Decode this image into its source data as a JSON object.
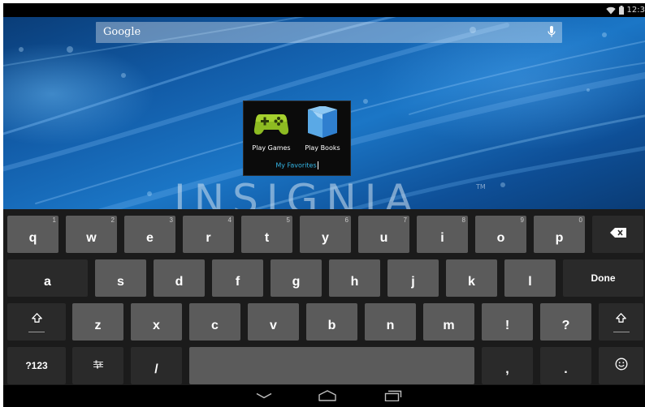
{
  "status_bar": {
    "time": "12:3"
  },
  "search": {
    "label": "Google"
  },
  "folder": {
    "apps": [
      {
        "label": "Play Games"
      },
      {
        "label": "Play Books"
      }
    ],
    "name": "My Favorites"
  },
  "wallpaper": {
    "brand": "INSIGNIA",
    "trademark": "TM"
  },
  "keyboard": {
    "row1": [
      {
        "label": "q",
        "hint": "1"
      },
      {
        "label": "w",
        "hint": "2"
      },
      {
        "label": "e",
        "hint": "3"
      },
      {
        "label": "r",
        "hint": "4"
      },
      {
        "label": "t",
        "hint": "5"
      },
      {
        "label": "y",
        "hint": "6"
      },
      {
        "label": "u",
        "hint": "7"
      },
      {
        "label": "i",
        "hint": "8"
      },
      {
        "label": "o",
        "hint": "9"
      },
      {
        "label": "p",
        "hint": "0"
      }
    ],
    "row2": [
      "a",
      "s",
      "d",
      "f",
      "g",
      "h",
      "j",
      "k",
      "l"
    ],
    "done_label": "Done",
    "row3": [
      "z",
      "x",
      "c",
      "v",
      "b",
      "n",
      "m",
      "!",
      "?"
    ],
    "symbols_label": "?123",
    "slash_label": "/",
    "comma_label": ",",
    "period_label": "."
  },
  "icons": [
    "wifi-icon",
    "battery-icon",
    "mic-icon",
    "play-games-icon",
    "play-books-icon",
    "backspace-icon",
    "shift-icon",
    "settings-icon",
    "emoji-icon",
    "hide-keyboard-icon",
    "home-icon",
    "recent-apps-icon"
  ]
}
